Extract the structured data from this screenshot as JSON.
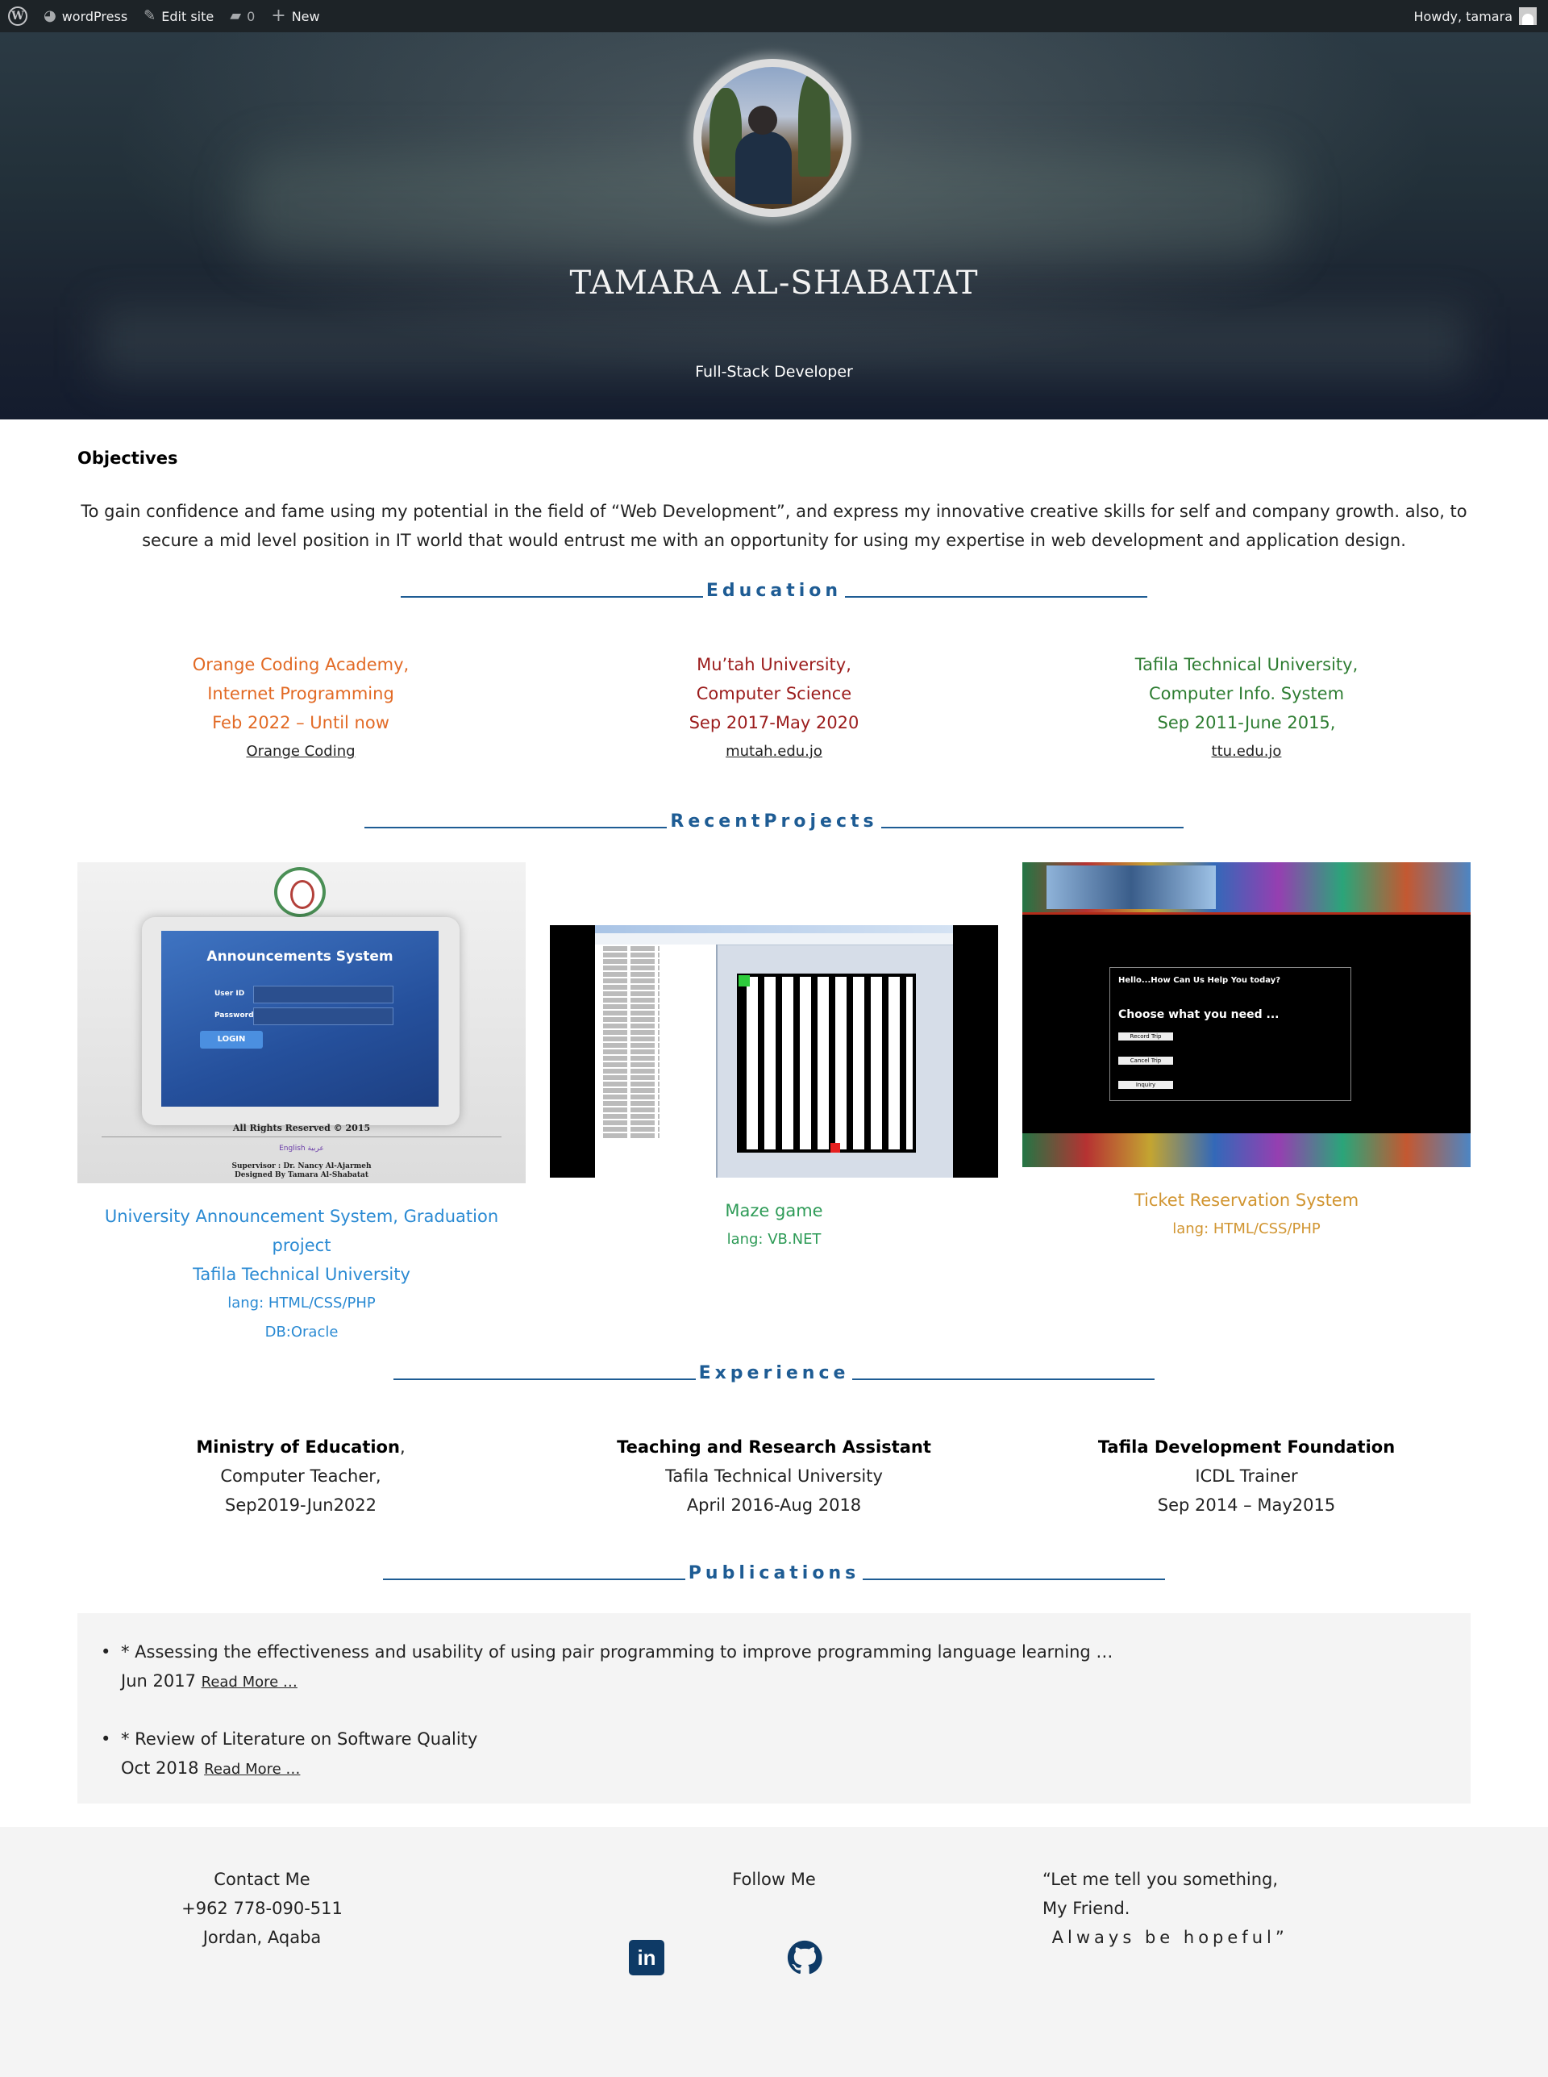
{
  "adminbar": {
    "site_label": "wordPress",
    "edit_label": "Edit site",
    "comments_count": "0",
    "new_label": "New",
    "greeting": "Howdy, tamara"
  },
  "hero": {
    "name": "TAMARA AL-SHABATAT",
    "tagline": "Full-Stack Developer"
  },
  "objectives": {
    "title": "Objectives",
    "text": "To gain confidence and fame using my potential in the field of “Web Development”, and express my innovative creative skills for self and company growth. also, to secure a mid level position in IT world that would entrust me with an opportunity for using my expertise in web development and application design."
  },
  "education": {
    "heading": "Education",
    "items": [
      {
        "line1": "Orange Coding Academy,",
        "line2": "Internet Programming",
        "line3": "Feb 2022 – Until now",
        "link": "Orange Coding"
      },
      {
        "line1": "Mu’tah University,",
        "line2": "Computer Science",
        "line3": "Sep 2017-May 2020",
        "link": "mutah.edu.jo"
      },
      {
        "line1": "Tafila Technical University,",
        "line2": "Computer Info. System",
        "line3": "Sep 2011-June 2015,",
        "link": "ttu.edu.jo"
      }
    ]
  },
  "projects": {
    "heading": "RecentProjects",
    "items": [
      {
        "title": "University Announcement System, Graduation project",
        "subtitle": "Tafila Technical University",
        "lang": "lang: HTML/CSS/PHP",
        "db": "DB:Oracle",
        "screenshot": {
          "panel_title": "Announcements System",
          "user_label": "User ID",
          "pass_label": "Password",
          "login_label": "LOGIN",
          "footer": "All Rights Reserved © 2015",
          "lang_links": "English   عربية",
          "supervisor": "Supervisor : Dr. Nancy Al-Ajarmeh",
          "designer": "Designed By Tamara Al-Shabatat"
        }
      },
      {
        "title": "Maze game",
        "lang": "lang: VB.NET"
      },
      {
        "title": "Ticket Reservation System",
        "lang": "lang: HTML/CSS/PHP",
        "screenshot": {
          "question": "Hello...How Can Us Help You today?",
          "choose": "Choose what you need ...",
          "btn1": "Record Trip",
          "btn2": "Cancel Trip",
          "btn3": "Inquiry"
        }
      }
    ]
  },
  "experience": {
    "heading": "Experience",
    "items": [
      {
        "title": "Ministry of Education",
        "suffix": ",",
        "line2": "Computer Teacher,",
        "line3": "Sep2019-Jun2022"
      },
      {
        "title": "Teaching and Research Assistant",
        "suffix": "",
        "line2": "Tafila Technical University",
        "line3": "April 2016-Aug 2018"
      },
      {
        "title": "Tafila Development Foundation",
        "suffix": "",
        "line2": "ICDL Trainer",
        "line3": "Sep 2014 – May2015"
      }
    ]
  },
  "publications": {
    "heading": "Publications",
    "items": [
      {
        "title": "* Assessing the effectiveness and usability of using pair programming to improve programming language learning …",
        "date": "Jun 2017",
        "read_more": "Read More …"
      },
      {
        "title": "* Review of Literature on Software Quality",
        "date": "Oct 2018",
        "read_more": "Read More …"
      }
    ]
  },
  "footer": {
    "contact_title": "Contact Me",
    "phone": "+962 778-090-511",
    "location": "Jordan, Aqaba",
    "follow_title": "Follow Me",
    "quote_line1": "“Let me tell you something,",
    "quote_line2": "My Friend.",
    "quote_line3": " Always be hopeful”",
    "linkedin_icon": "linkedin-icon",
    "github_icon": "github-icon"
  },
  "colors": {
    "heading_blue": "#1e5c94",
    "orange": "#e26a25",
    "maroon": "#9b1c1c",
    "green": "#2e7d32",
    "project_blue": "#2a8ad3",
    "project_green": "#2e9b57",
    "project_gold": "#d19531"
  }
}
